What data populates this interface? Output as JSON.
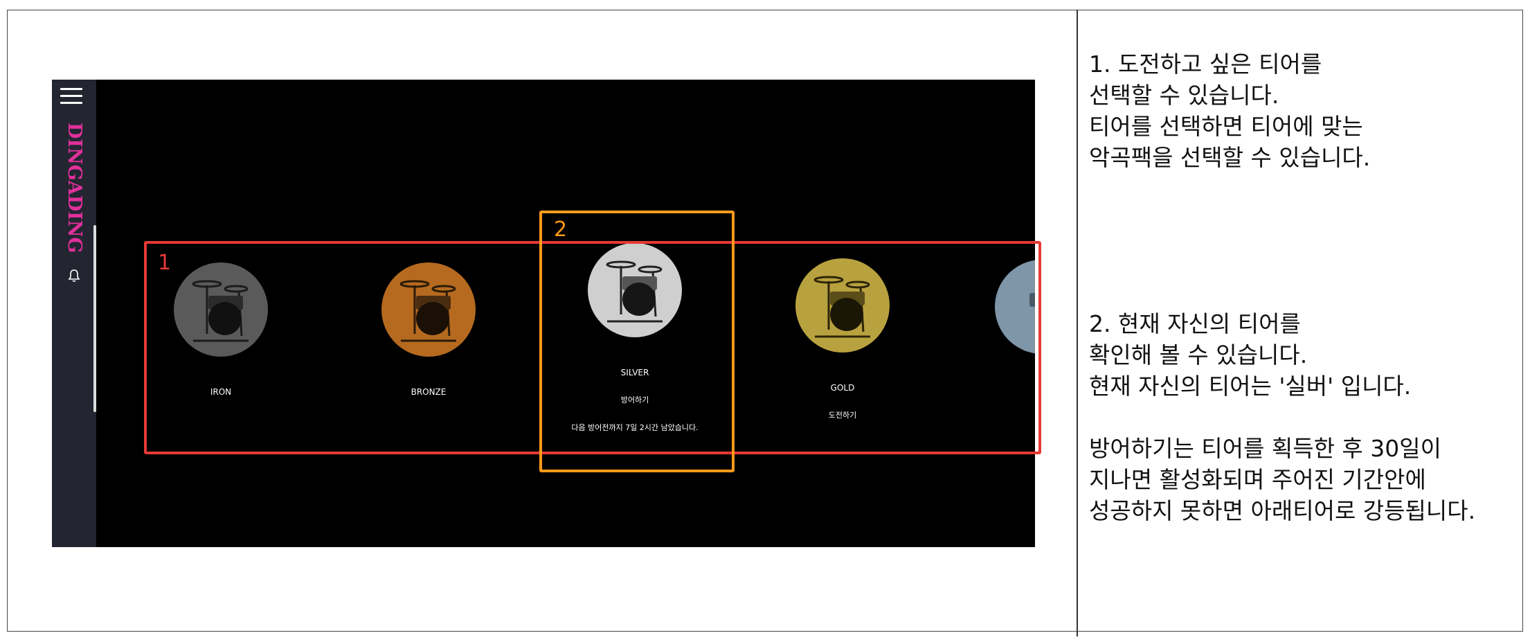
{
  "app": {
    "logo_text": "DINGADING",
    "icons": {
      "menu": "menu-icon",
      "notifications": "bell-icon"
    }
  },
  "tiers": [
    {
      "name": "IRON",
      "color": "#5a5a5a"
    },
    {
      "name": "BRONZE",
      "color": "#b56a1f"
    },
    {
      "name": "SILVER",
      "color": "#cfcfcf",
      "action": "방어하기",
      "notice": "다음 방어전까지 7일 2시간 남았습니다.",
      "current": true
    },
    {
      "name": "GOLD",
      "color": "#b8a13f",
      "action": "도전하기"
    },
    {
      "name": "",
      "color": "#7f95a8"
    }
  ],
  "annotations": {
    "label_1": "1",
    "label_2": "2",
    "colors": {
      "red": "#e53935",
      "orange": "#ff9a1a"
    }
  },
  "notes": {
    "note_1": "1. 도전하고 싶은 티어를\n선택할 수 있습니다.\n티어를 선택하면 티어에 맞는\n악곡팩을 선택할 수 있습니다.",
    "note_2": "2. 현재 자신의 티어를\n확인해 볼 수 있습니다.\n현재 자신의 티어는 '실버' 입니다.\n\n방어하기는 티어를 획득한 후 30일이\n지나면 활성화되며 주어진 기간안에\n성공하지 못하면 아래티어로 강등됩니다."
  }
}
